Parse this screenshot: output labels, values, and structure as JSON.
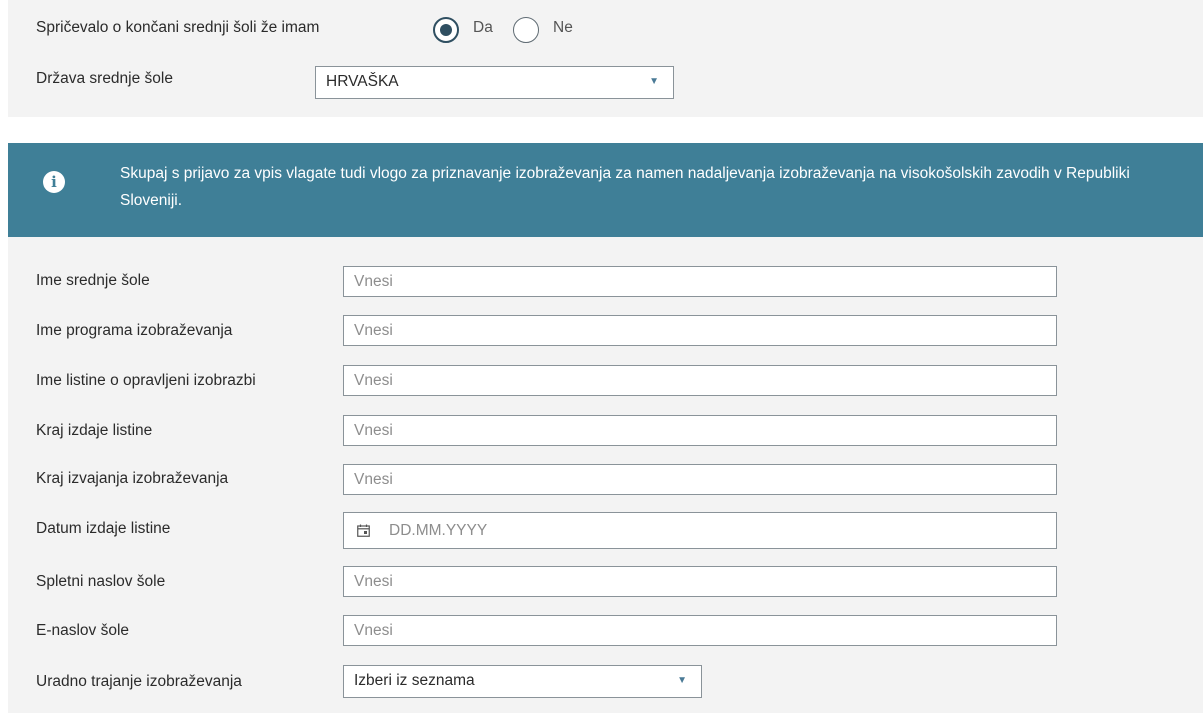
{
  "certificate_question": {
    "label": "Spričevalo o končani srednji šoli že imam",
    "options": [
      {
        "label": "Da",
        "selected": true
      },
      {
        "label": "Ne",
        "selected": false
      }
    ]
  },
  "country": {
    "label": "Država srednje šole",
    "value": "HRVAŠKA"
  },
  "info_banner": {
    "icon": "info-icon",
    "text": "Skupaj s prijavo za vpis vlagate tudi vlogo za priznavanje izobraževanja za namen nadaljevanja izobraževanja na visokošolskih zavodih v Republiki Sloveniji.",
    "color": "#3f7f97"
  },
  "fields": [
    {
      "label": "Ime srednje šole",
      "placeholder": "Vnesi"
    },
    {
      "label": "Ime programa izobraževanja",
      "placeholder": "Vnesi"
    },
    {
      "label": "Ime listine o opravljeni izobrazbi",
      "placeholder": "Vnesi"
    },
    {
      "label": "Kraj izdaje listine",
      "placeholder": "Vnesi"
    },
    {
      "label": "Kraj izvajanja izobraževanja",
      "placeholder": "Vnesi"
    },
    {
      "label": "Datum izdaje listine",
      "placeholder": "DD.MM.YYYY",
      "icon": "calendar-icon"
    },
    {
      "label": "Spletni naslov šole",
      "placeholder": "Vnesi"
    },
    {
      "label": "E-naslov šole",
      "placeholder": "Vnesi"
    }
  ],
  "duration": {
    "label": "Uradno trajanje izobraževanja",
    "value": "Izberi iz seznama"
  }
}
